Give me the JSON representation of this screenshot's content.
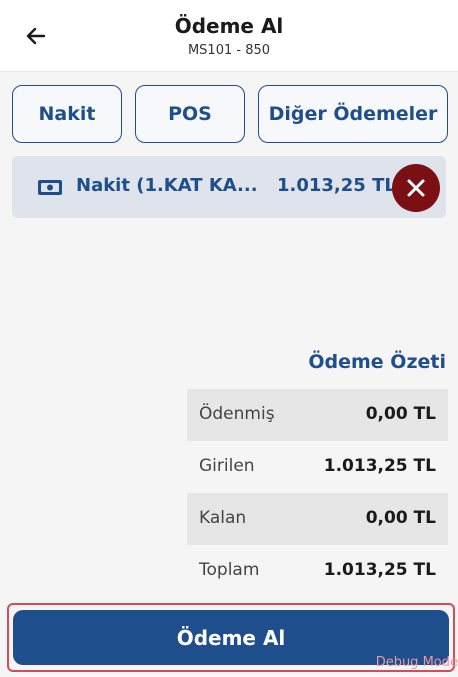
{
  "header": {
    "title": "Ödeme Al",
    "subtitle": "MS101 - 850"
  },
  "tabs": [
    {
      "label": "Nakit"
    },
    {
      "label": "POS"
    },
    {
      "label": "Diğer Ödemeler"
    }
  ],
  "payment": {
    "icon": "cash-icon",
    "name": "Nakit (1.KAT KA...",
    "amount": "1.013,25 TL"
  },
  "summary": {
    "title": "Ödeme Özeti",
    "rows": [
      {
        "label": "Ödenmiş",
        "value": "0,00 TL"
      },
      {
        "label": "Girilen",
        "value": "1.013,25 TL"
      },
      {
        "label": "Kalan",
        "value": "0,00 TL"
      },
      {
        "label": "Toplam",
        "value": "1.013,25 TL"
      }
    ]
  },
  "submit_label": "Ödeme Al",
  "debug_label": "Debug Mode",
  "colors": {
    "primary": "#1f4e8c",
    "danger": "#7a0f14",
    "row_bg": "#dfe3ec"
  }
}
